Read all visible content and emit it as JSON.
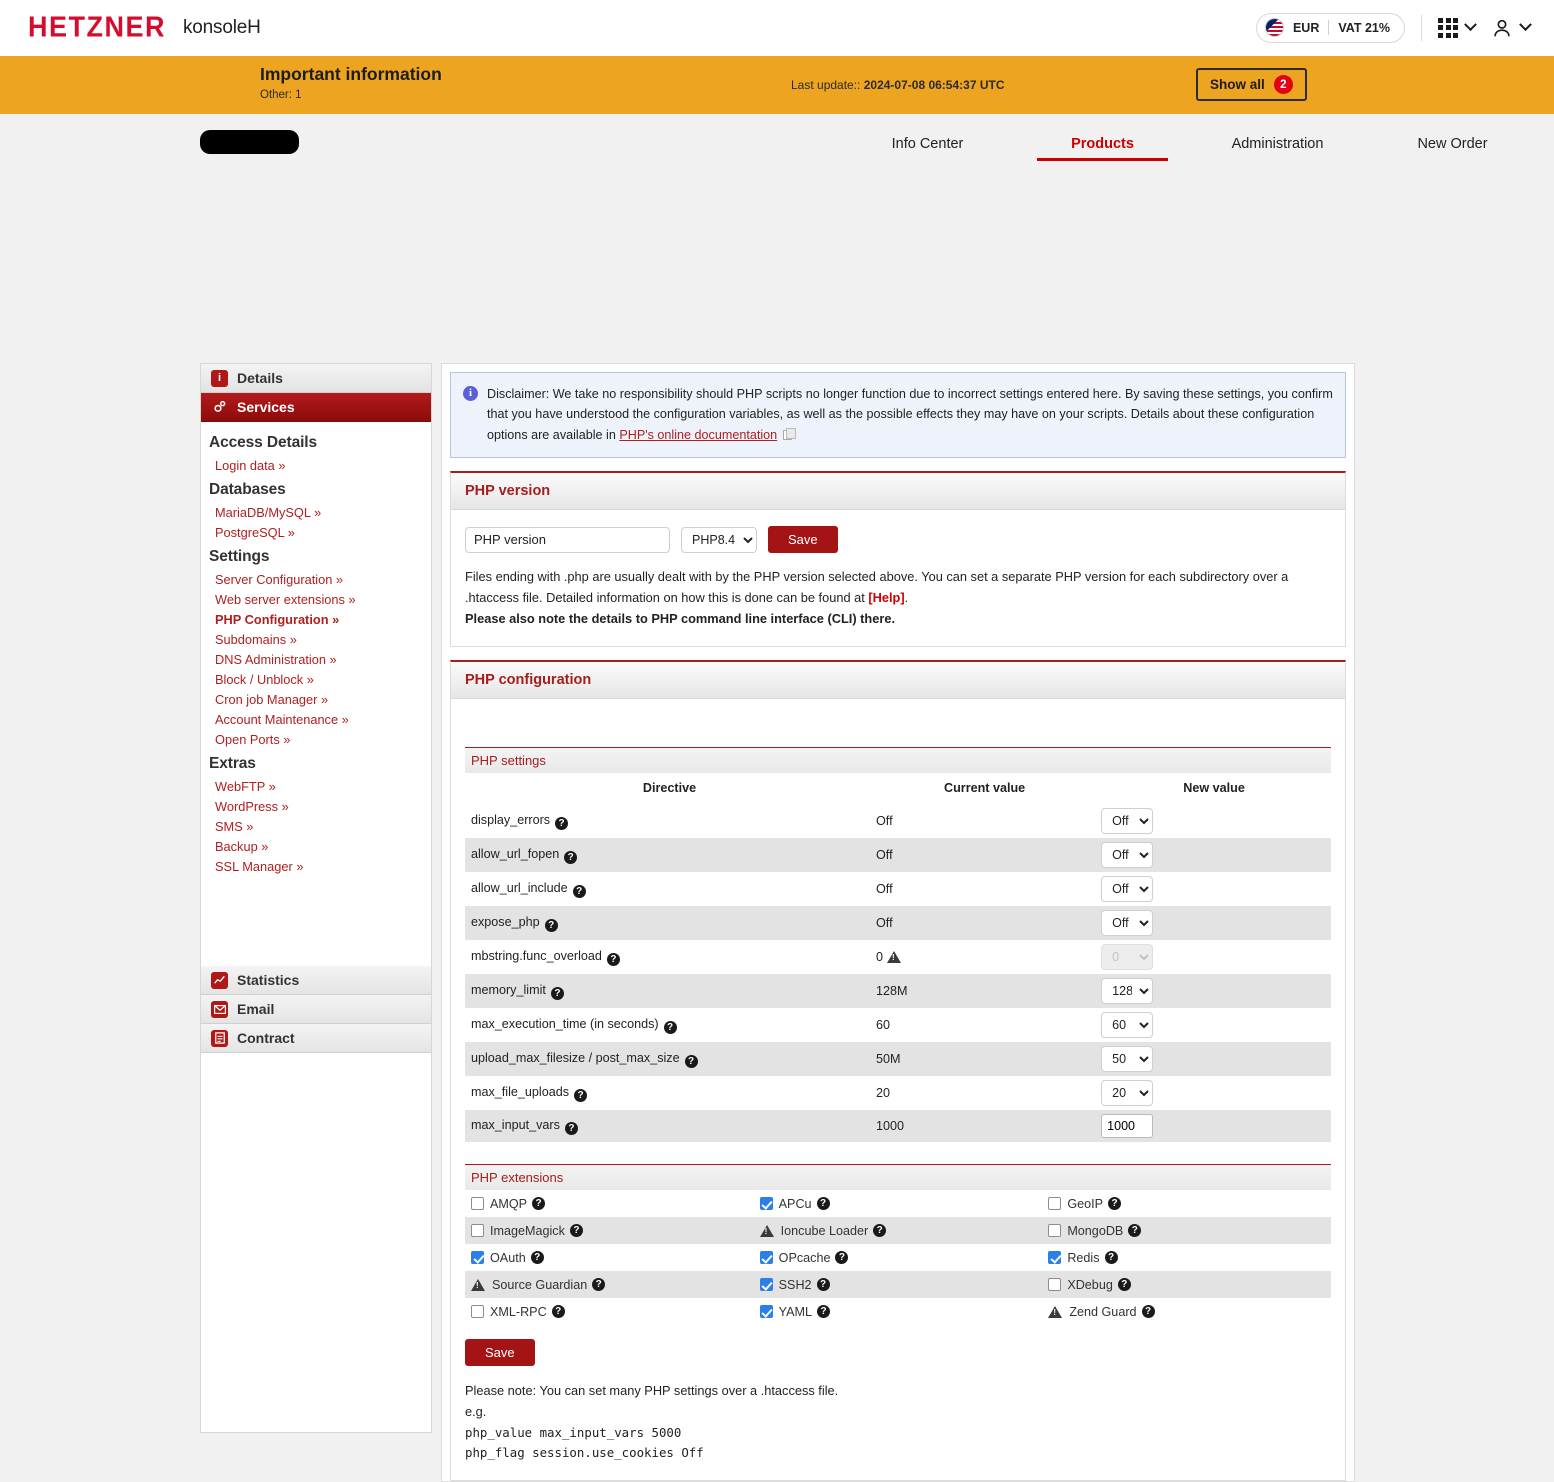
{
  "header": {
    "logo": "HETZNER",
    "product": "konsoleH",
    "currency": "EUR",
    "vat": "VAT 21%",
    "flag_icon": "us-uk-flag-icon",
    "apps_icon": "grid-apps-icon",
    "account_icon": "user-account-icon"
  },
  "notice": {
    "title": "Important information",
    "subtitle": "Other: 1",
    "last_update_label": "Last update::",
    "last_update_value": "2024-07-08 06:54:37 UTC",
    "show_all": "Show all",
    "count": "2"
  },
  "nav": {
    "items": [
      {
        "label": "Info Center",
        "active": false
      },
      {
        "label": "Products",
        "active": true
      },
      {
        "label": "Administration",
        "active": false
      },
      {
        "label": "New Order",
        "active": false
      }
    ]
  },
  "sidebar": {
    "tabs": [
      {
        "label": "Details",
        "icon": "info-icon",
        "active": false
      },
      {
        "label": "Services",
        "icon": "gears-icon",
        "active": true
      }
    ],
    "groups": [
      {
        "heading": "Access Details",
        "links": [
          {
            "label": "Login data »",
            "current": false
          }
        ]
      },
      {
        "heading": "Databases",
        "links": [
          {
            "label": "MariaDB/MySQL »",
            "current": false
          },
          {
            "label": "PostgreSQL »",
            "current": false
          }
        ]
      },
      {
        "heading": "Settings",
        "links": [
          {
            "label": "Server Configuration »",
            "current": false
          },
          {
            "label": "Web server extensions »",
            "current": false
          },
          {
            "label": "PHP Configuration »",
            "current": true
          },
          {
            "label": "Subdomains »",
            "current": false
          },
          {
            "label": "DNS Administration »",
            "current": false
          },
          {
            "label": "Block / Unblock »",
            "current": false
          },
          {
            "label": "Cron job Manager »",
            "current": false
          },
          {
            "label": "Account Maintenance »",
            "current": false
          },
          {
            "label": "Open Ports »",
            "current": false
          }
        ]
      },
      {
        "heading": "Extras",
        "links": [
          {
            "label": "WebFTP »",
            "current": false
          },
          {
            "label": "WordPress »",
            "current": false
          },
          {
            "label": "SMS »",
            "current": false
          },
          {
            "label": "Backup »",
            "current": false
          },
          {
            "label": "SSL Manager »",
            "current": false
          }
        ]
      }
    ],
    "bottom_tabs": [
      {
        "label": "Statistics",
        "icon": "chart-icon"
      },
      {
        "label": "Email",
        "icon": "envelope-icon"
      },
      {
        "label": "Contract",
        "icon": "document-icon"
      }
    ]
  },
  "disclaimer": {
    "icon": "info-circle-icon",
    "text_before": "Disclaimer: We take no responsibility should PHP scripts no longer function due to incorrect settings entered here. By saving these settings, you confirm that you have understood the configuration variables, as well as the possible effects they may have on your scripts. Details about these configuration options are available in ",
    "link": "PHP's online documentation",
    "copy_icon": "copy-icon"
  },
  "php_version": {
    "panel_title": "PHP version",
    "field_value": "PHP version",
    "selected": "PHP8.4",
    "options": [
      "PHP8.4"
    ],
    "save_label": "Save",
    "desc_line1": "Files ending with .php are usually dealt with by the PHP version selected above. You can set a separate PHP version for each subdirectory over a .htaccess file. Detailed information on how this is done can be found at ",
    "help_label": "[Help]",
    "desc_bold": "Please also note the details to PHP command line interface (CLI) there."
  },
  "php_config": {
    "panel_title": "PHP configuration",
    "settings_title": "PHP settings",
    "columns": [
      "Directive",
      "Current value",
      "New value"
    ],
    "rows": [
      {
        "directive": "display_errors",
        "current": "Off",
        "new": "Off",
        "control": "select",
        "warn": false,
        "disabled": false
      },
      {
        "directive": "allow_url_fopen",
        "current": "Off",
        "new": "Off",
        "control": "select",
        "warn": false,
        "disabled": false
      },
      {
        "directive": "allow_url_include",
        "current": "Off",
        "new": "Off",
        "control": "select",
        "warn": false,
        "disabled": false
      },
      {
        "directive": "expose_php",
        "current": "Off",
        "new": "Off",
        "control": "select",
        "warn": false,
        "disabled": false
      },
      {
        "directive": "mbstring.func_overload",
        "current": "0",
        "new": "0",
        "control": "select",
        "warn": true,
        "disabled": true
      },
      {
        "directive": "memory_limit",
        "current": "128M",
        "new": "128",
        "control": "select",
        "warn": false,
        "disabled": false
      },
      {
        "directive": "max_execution_time (in seconds)",
        "current": "60",
        "new": "60",
        "control": "select",
        "warn": false,
        "disabled": false
      },
      {
        "directive": "upload_max_filesize / post_max_size",
        "current": "50M",
        "new": "50",
        "control": "select",
        "warn": false,
        "disabled": false
      },
      {
        "directive": "max_file_uploads",
        "current": "20",
        "new": "20",
        "control": "select",
        "warn": false,
        "disabled": false
      },
      {
        "directive": "max_input_vars",
        "current": "1000",
        "new": "1000",
        "control": "text",
        "warn": false,
        "disabled": false
      }
    ],
    "extensions_title": "PHP extensions",
    "extensions": [
      [
        {
          "label": "AMQP",
          "state": "unchecked"
        },
        {
          "label": "APCu",
          "state": "checked"
        },
        {
          "label": "GeoIP",
          "state": "unchecked"
        }
      ],
      [
        {
          "label": "ImageMagick",
          "state": "unchecked"
        },
        {
          "label": "Ioncube Loader",
          "state": "warning"
        },
        {
          "label": "MongoDB",
          "state": "unchecked"
        }
      ],
      [
        {
          "label": "OAuth",
          "state": "checked"
        },
        {
          "label": "OPcache",
          "state": "checked"
        },
        {
          "label": "Redis",
          "state": "checked"
        }
      ],
      [
        {
          "label": "Source Guardian",
          "state": "warning"
        },
        {
          "label": "SSH2",
          "state": "checked"
        },
        {
          "label": "XDebug",
          "state": "unchecked"
        }
      ],
      [
        {
          "label": "XML-RPC",
          "state": "unchecked"
        },
        {
          "label": "YAML",
          "state": "checked"
        },
        {
          "label": "Zend Guard",
          "state": "warning"
        }
      ]
    ],
    "save_label": "Save",
    "note_line1": "Please note: You can set many PHP settings over a .htaccess file.",
    "note_line2": "e.g.",
    "note_line3": "php_value max_input_vars 5000",
    "note_line4": "php_flag session.use_cookies Off"
  },
  "colors": {
    "brand_red": "#d50c2d",
    "accent_red": "#a41414",
    "notice_orange": "#eda421",
    "badge_red": "#e3000f",
    "checkbox_blue": "#2a7fe8"
  }
}
